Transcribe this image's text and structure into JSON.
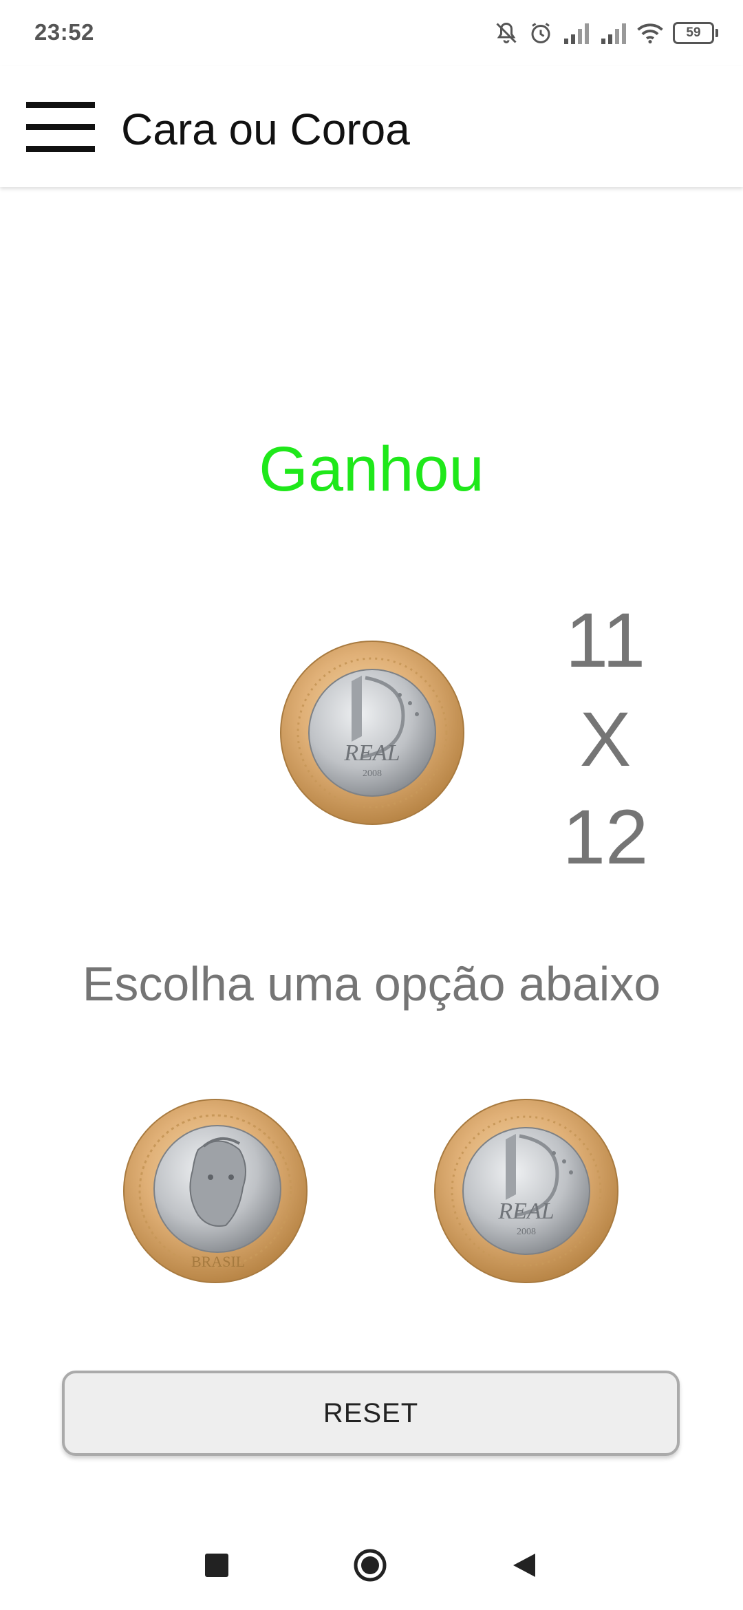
{
  "status_bar": {
    "time": "23:52",
    "battery_level": "59",
    "icons": [
      "dnd-off-icon",
      "alarm-icon",
      "signal-icon",
      "signal-icon",
      "wifi-icon",
      "battery-icon"
    ]
  },
  "app_bar": {
    "title": "Cara ou Coroa",
    "menu_icon": "hamburger-menu-icon"
  },
  "game": {
    "result": "Ganhou",
    "result_color": "#1fe81a",
    "result_coin": "coin-tails-icon",
    "score_player": "11",
    "score_separator": "X",
    "score_cpu": "12",
    "prompt": "Escolha uma opção abaixo",
    "choices": [
      {
        "name": "heads",
        "icon": "coin-heads-icon"
      },
      {
        "name": "tails",
        "icon": "coin-tails-icon"
      }
    ],
    "reset_label": "RESET"
  },
  "colors": {
    "coin_gold": "#d9aa6a",
    "coin_silver": "#b8babd",
    "text_gray": "#757575"
  },
  "nav_bar": {
    "icons": [
      "recents-icon",
      "home-icon",
      "back-icon"
    ]
  }
}
